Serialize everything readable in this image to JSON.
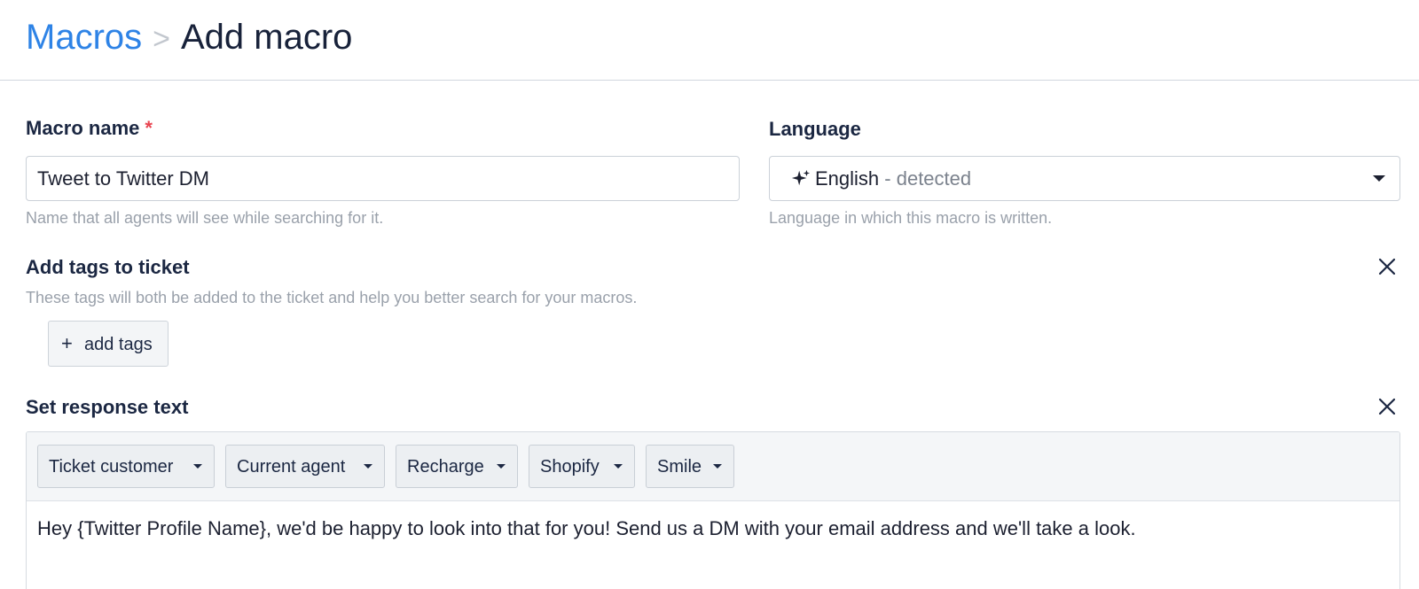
{
  "breadcrumb": {
    "parent": "Macros",
    "separator": ">",
    "current": "Add macro"
  },
  "macro_name": {
    "label": "Macro name",
    "required_marker": "*",
    "value": "Tweet to Twitter DM",
    "help": "Name that all agents will see while searching for it."
  },
  "language": {
    "label": "Language",
    "value": "English",
    "suffix": "- detected",
    "help": "Language in which this macro is written.",
    "icon": "sparkle-icon"
  },
  "tags": {
    "label": "Add tags to ticket",
    "help": "These tags will both be added to the ticket and help you better search for your macros.",
    "button_plus": "+",
    "button_label": "add tags"
  },
  "response": {
    "label": "Set response text",
    "variables": [
      {
        "label": "Ticket customer"
      },
      {
        "label": "Current agent"
      },
      {
        "label": "Recharge"
      },
      {
        "label": "Shopify"
      },
      {
        "label": "Smile"
      }
    ],
    "text": "Hey {Twitter Profile Name}, we'd be happy to look into that for you! Send us a DM with your email address and we'll take a look."
  },
  "colors": {
    "link": "#2e83e6",
    "required": "#e8434f",
    "heading": "#1b2742",
    "help": "#9aa1ab"
  }
}
